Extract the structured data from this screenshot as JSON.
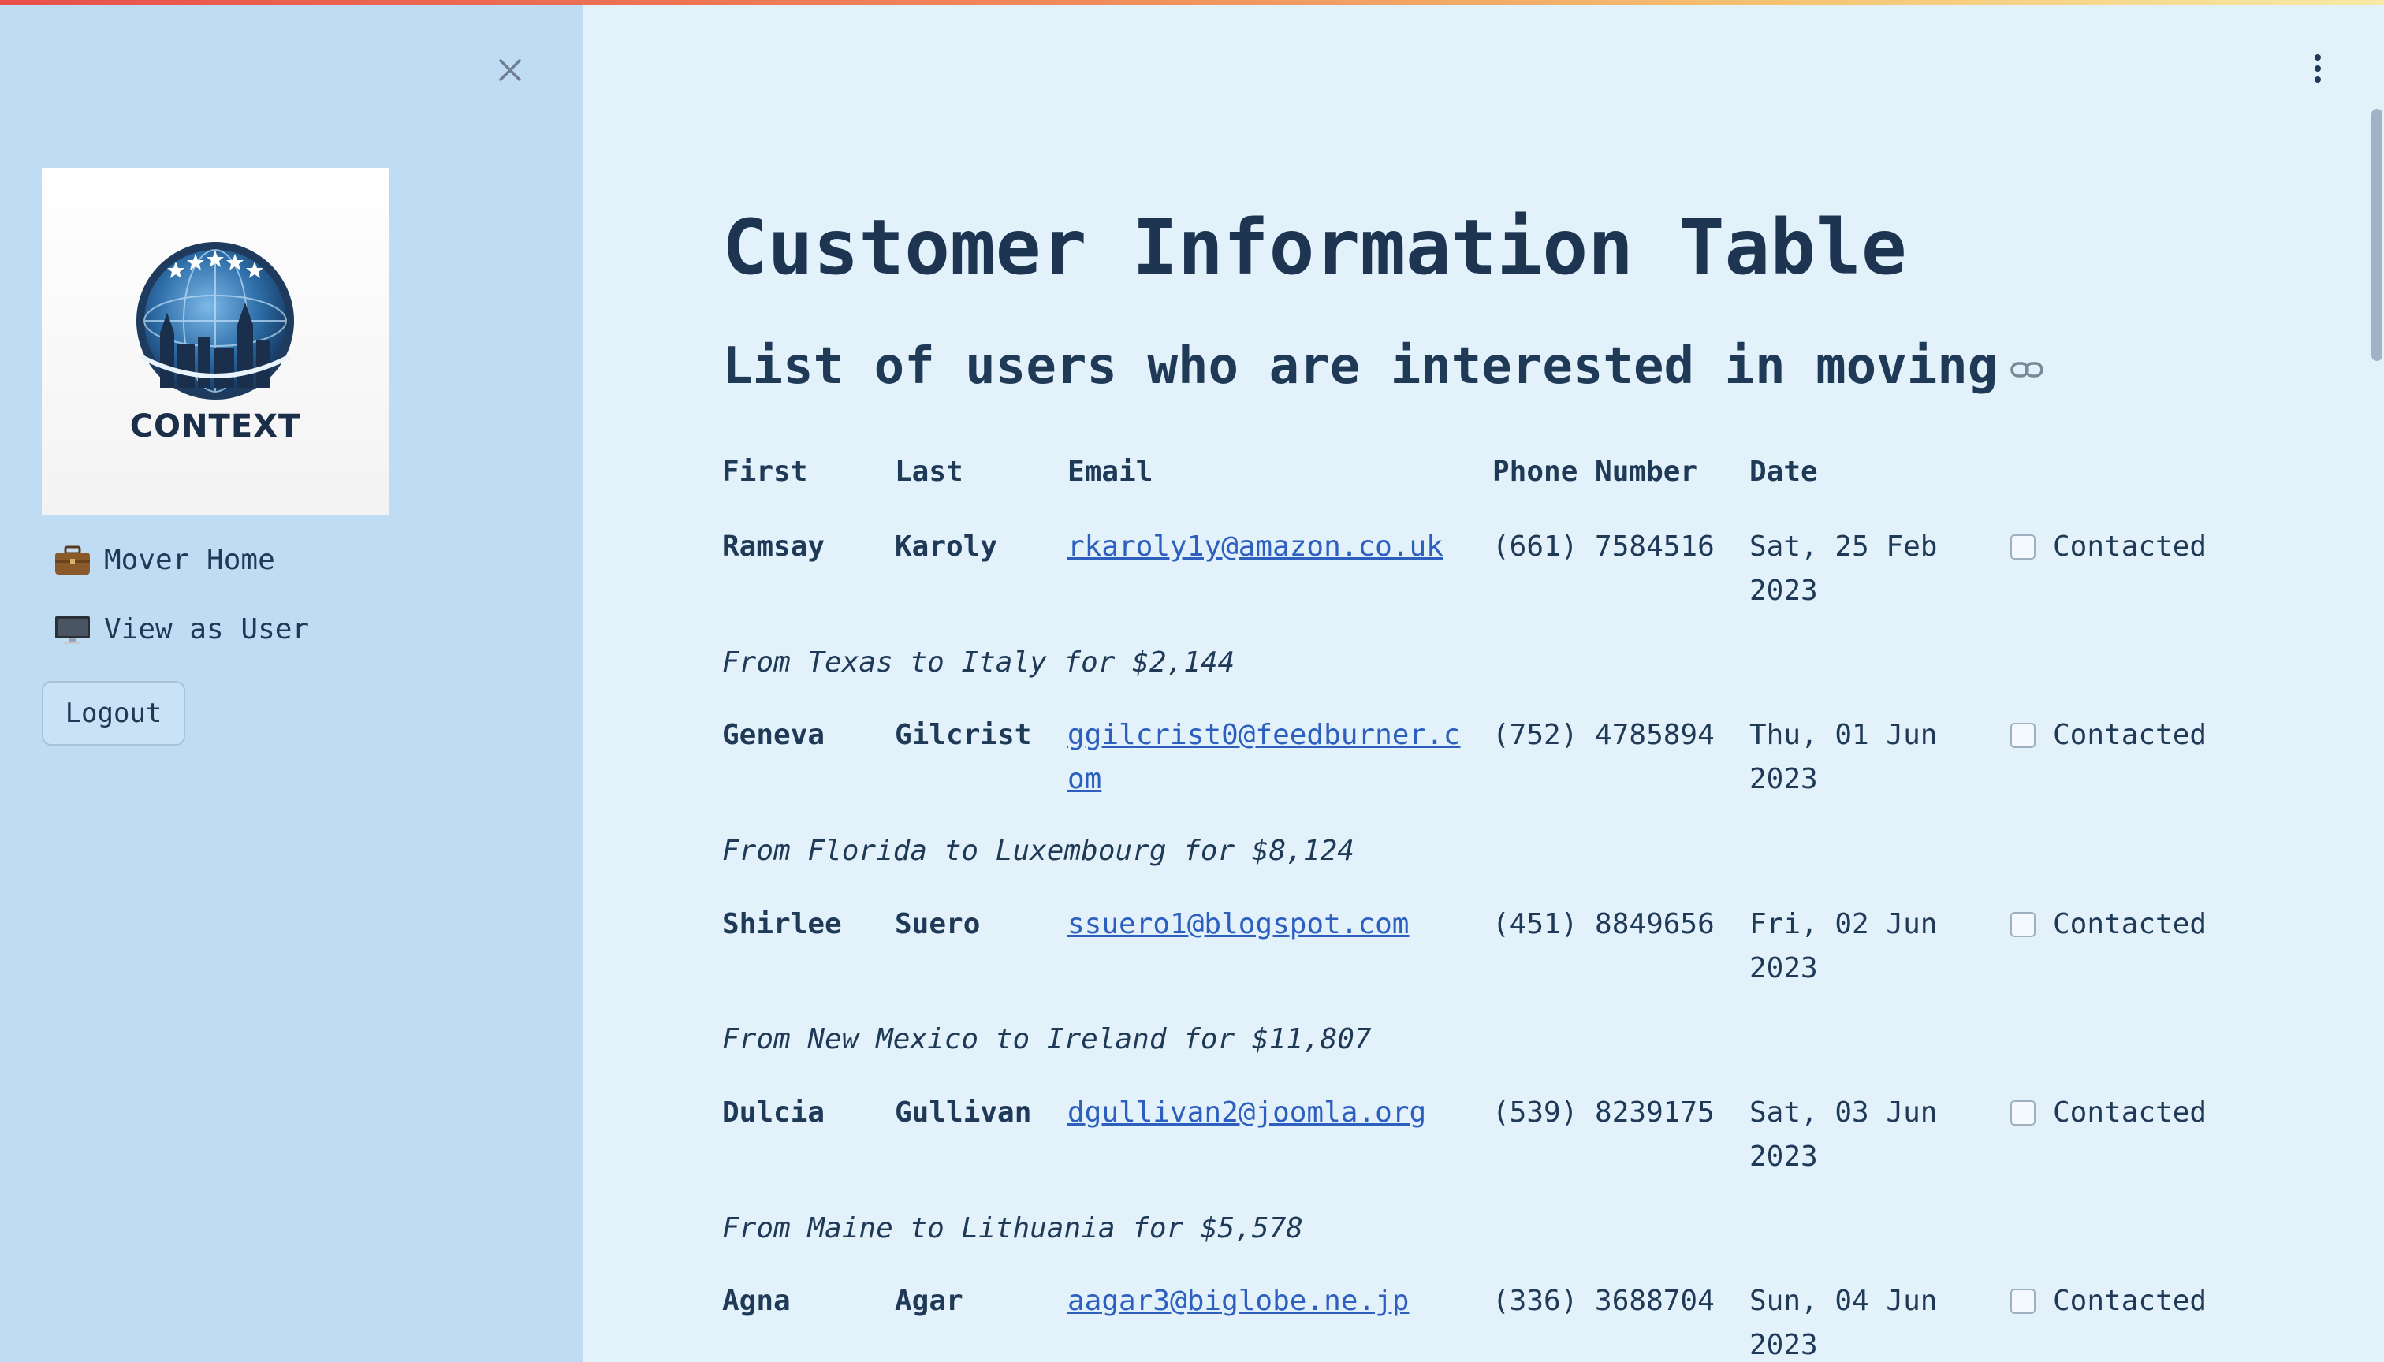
{
  "sidebar": {
    "logo_text": "CONTEXT",
    "nav": [
      {
        "label": "Mover Home",
        "icon": "briefcase-icon"
      },
      {
        "label": "View as User",
        "icon": "monitor-icon"
      }
    ],
    "logout_label": "Logout"
  },
  "main": {
    "title": "Customer Information Table",
    "subtitle": "List of users who are interested in moving",
    "headers": {
      "first": "First",
      "last": "Last",
      "email": "Email",
      "phone": "Phone Number",
      "date": "Date"
    },
    "rows": [
      {
        "first": "Ramsay",
        "last": "Karoly",
        "email": "rkaroly1y@amazon.co.uk",
        "phone": "(661) 7584516",
        "date": "Sat, 25 Feb 2023",
        "contacted_label": "Contacted",
        "note": "From Texas to Italy for $2,144"
      },
      {
        "first": "Geneva",
        "last": "Gilcrist",
        "email": "ggilcrist0@feedburner.com",
        "phone": "(752) 4785894",
        "date": "Thu, 01 Jun 2023",
        "contacted_label": "Contacted",
        "note": "From Florida to Luxembourg for $8,124"
      },
      {
        "first": "Shirlee",
        "last": "Suero",
        "email": "ssuero1@blogspot.com",
        "phone": "(451) 8849656",
        "date": "Fri, 02 Jun 2023",
        "contacted_label": "Contacted",
        "note": "From New Mexico to Ireland for $11,807"
      },
      {
        "first": "Dulcia",
        "last": "Gullivan",
        "email": "dgullivan2@joomla.org",
        "phone": "(539) 8239175",
        "date": "Sat, 03 Jun 2023",
        "contacted_label": "Contacted",
        "note": "From Maine to Lithuania for $5,578"
      },
      {
        "first": "Agna",
        "last": "Agar",
        "email": "aagar3@biglobe.ne.jp",
        "phone": "(336) 3688704",
        "date": "Sun, 04 Jun 2023",
        "contacted_label": "Contacted",
        "note": ""
      }
    ]
  },
  "colors": {
    "sidebar_bg": "#bfdcf3",
    "main_bg": "#e3f1fb",
    "text": "#1f3a57",
    "link": "#2d5fbf"
  }
}
